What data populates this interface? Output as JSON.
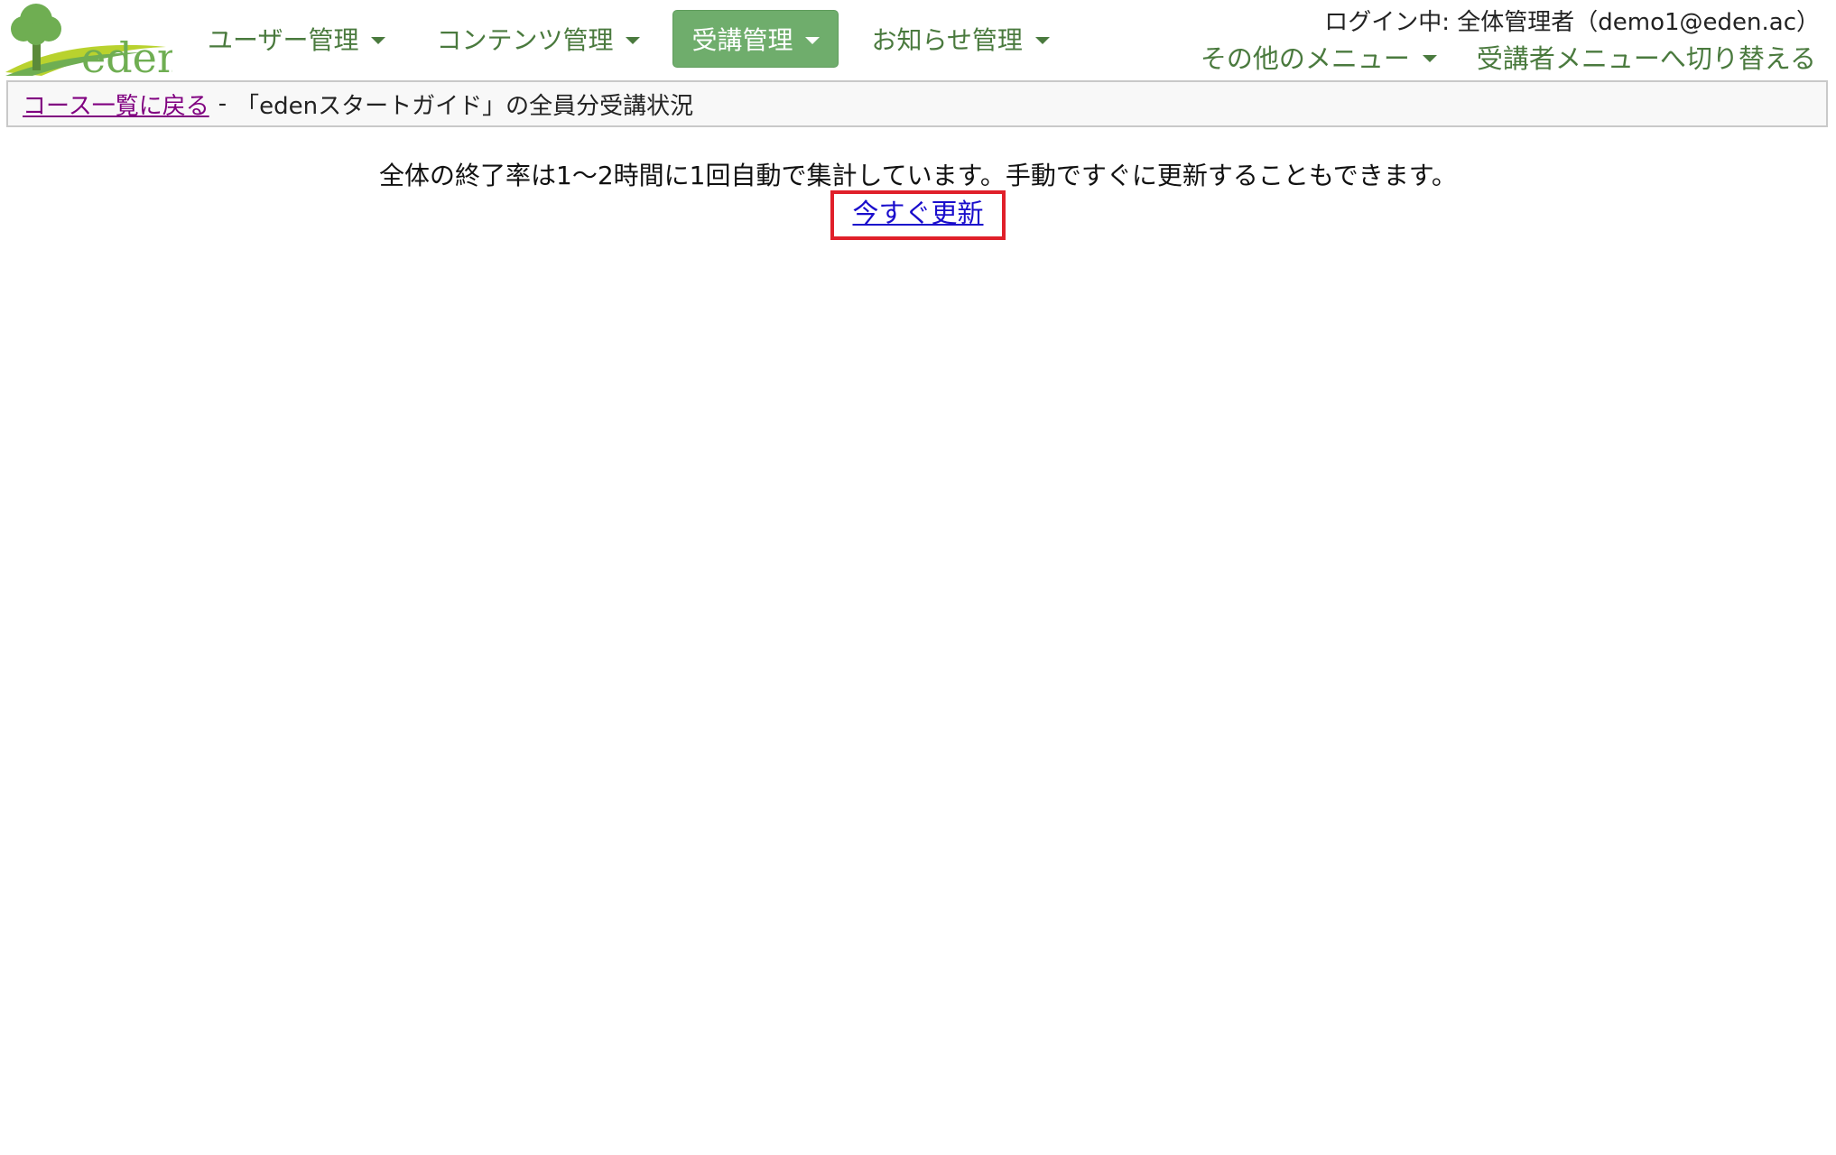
{
  "header": {
    "logo_text": "eden",
    "nav": [
      {
        "label": "ユーザー管理",
        "active": false
      },
      {
        "label": "コンテンツ管理",
        "active": false
      },
      {
        "label": "受講管理",
        "active": true
      },
      {
        "label": "お知らせ管理",
        "active": false
      }
    ],
    "login_info": "ログイン中: 全体管理者（demo1@eden.ac）",
    "other_menu_label": "その他のメニュー",
    "switch_menu_label": "受講者メニューへ切り替える"
  },
  "breadcrumb": {
    "back_link": "コース一覧に戻る",
    "separator": "-",
    "current": "「edenスタートガイド」の全員分受講状況"
  },
  "main": {
    "info_text": "全体の終了率は1〜2時間に1回自動で集計しています。手動ですぐに更新することもできます。",
    "update_link": "今すぐ更新"
  },
  "colors": {
    "nav_text": "#4a7a3e",
    "nav_active_bg": "#6fad6c",
    "visited_link": "#800080",
    "link": "#1a0dcc",
    "highlight_box": "#e0202a"
  }
}
